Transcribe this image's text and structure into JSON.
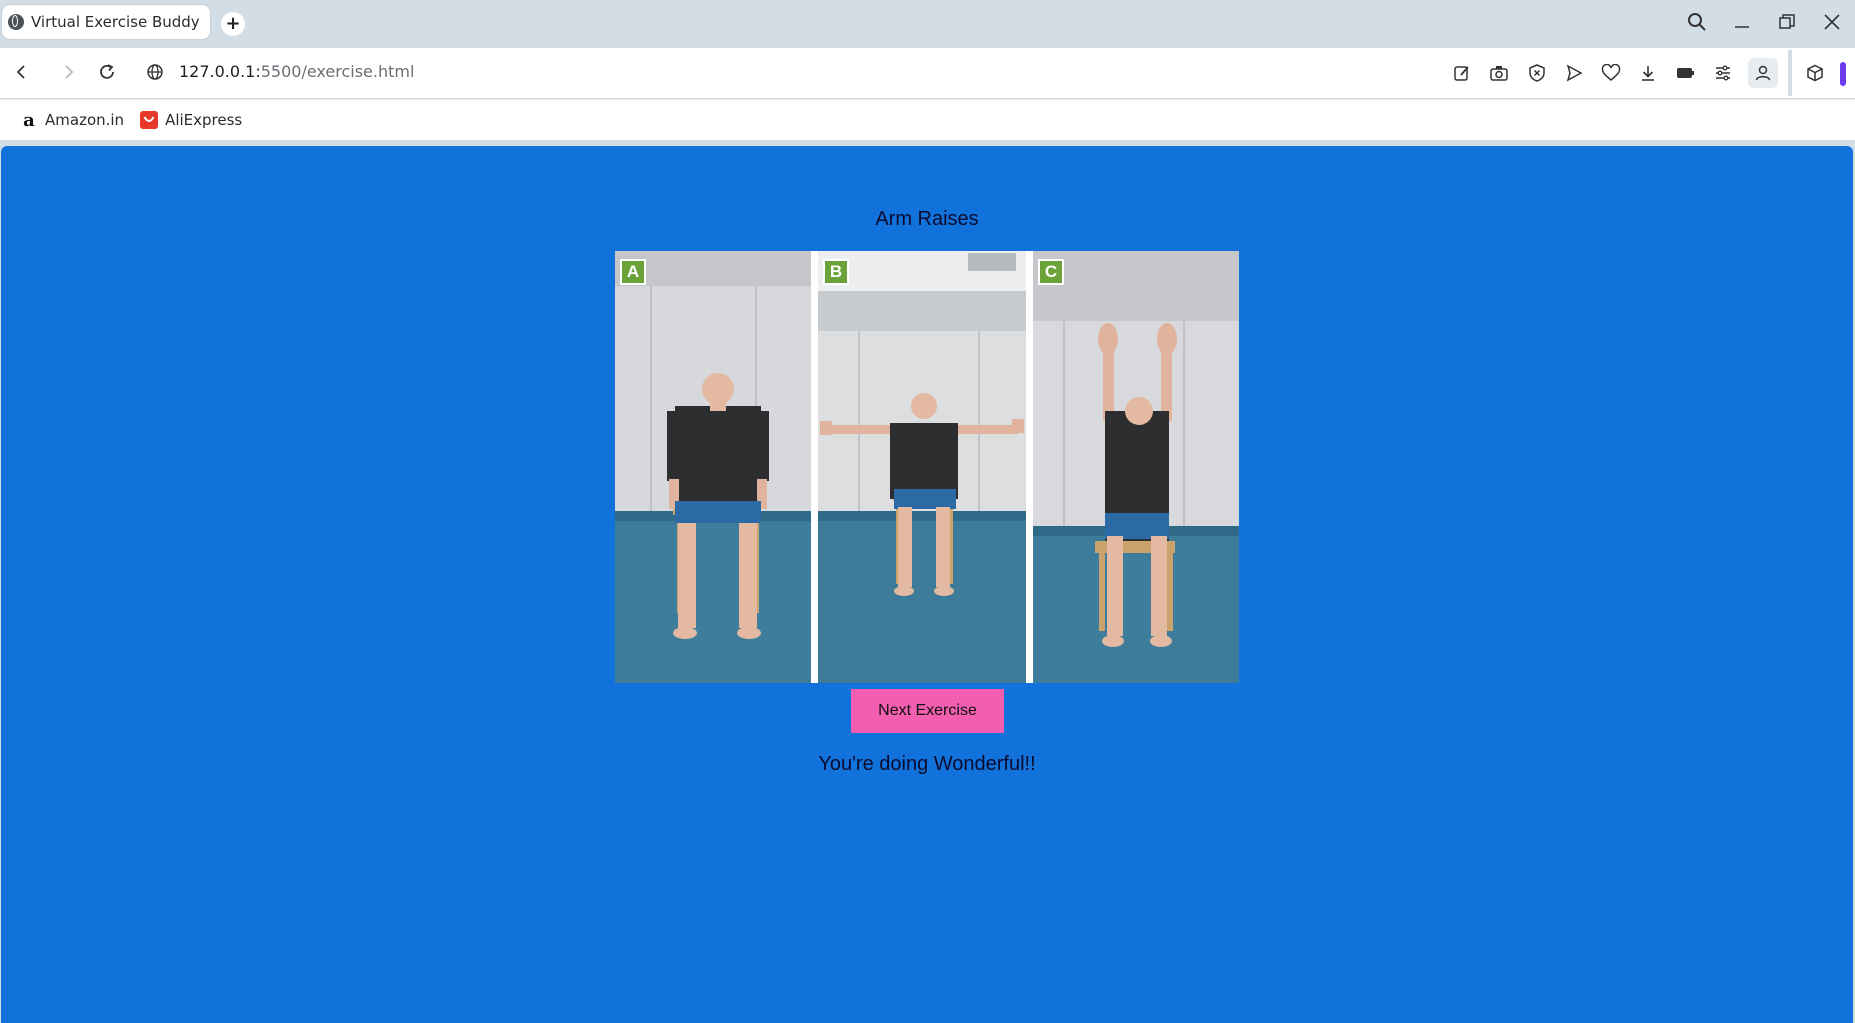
{
  "browser": {
    "tab_title": "Virtual Exercise Buddy",
    "url_host": "127.0.0.1:",
    "url_path": "5500/exercise.html",
    "bookmarks": [
      {
        "label": "Amazon.in",
        "icon": "amazon-icon"
      },
      {
        "label": "AliExpress",
        "icon": "aliexpress-icon"
      }
    ]
  },
  "page": {
    "title": "Arm Raises",
    "panels": [
      {
        "label": "A",
        "pose": "arms-down"
      },
      {
        "label": "B",
        "pose": "arms-out"
      },
      {
        "label": "C",
        "pose": "arms-up"
      }
    ],
    "next_button": "Next Exercise",
    "encouragement": "You're doing Wonderful!!"
  },
  "colors": {
    "page_background": "#1172dc",
    "button": "#f25eb0",
    "label_badge": "#6ba33a"
  }
}
